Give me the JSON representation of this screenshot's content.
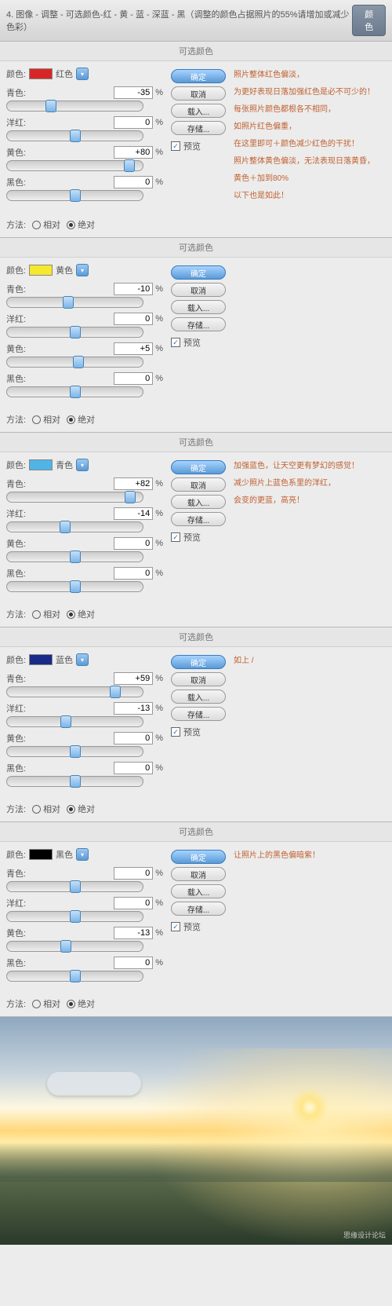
{
  "header": {
    "title": "4. 图像 - 调整 - 可选颜色-红 - 黄 - 蓝 - 深蓝 - 黑（调整的颜色占据照片的55%请增加或减少色彩）",
    "button": "颜色"
  },
  "panel_title": "可选颜色",
  "color_label_prefix": "颜色:",
  "slider_labels": {
    "cyan": "青色:",
    "magenta": "洋红:",
    "yellow": "黄色:",
    "black": "黑色:"
  },
  "buttons": {
    "ok": "确定",
    "cancel": "取消",
    "load": "载入...",
    "save": "存储..."
  },
  "preview": "预览",
  "method": {
    "label": "方法:",
    "relative": "相对",
    "absolute": "绝对"
  },
  "panels": [
    {
      "color_name": "红色",
      "swatch": "#d82626",
      "cyan": -35,
      "magenta": 0,
      "yellow": 80,
      "black": 0,
      "notes": [
        "照片整体红色偏淡，",
        "为更好表现日落加强红色是必不可少的！",
        "每张照片颜色都根各不相同，",
        "如照片红色偏重，",
        "在这里即可＋颜色减少红色的干扰！",
        "照片整体黄色偏淡，无法表现日落黄昏，",
        "黄色＋加到80%",
        "以下也是如此！"
      ]
    },
    {
      "color_name": "黄色",
      "swatch": "#f5e82e",
      "cyan": -10,
      "magenta": 0,
      "yellow": 5,
      "black": 0,
      "notes": []
    },
    {
      "color_name": "青色",
      "swatch": "#4fb4e6",
      "cyan": 82,
      "magenta": -14,
      "yellow": 0,
      "black": 0,
      "notes": [
        "加强蓝色，让天空更有梦幻的感觉！",
        "减少照片上蓝色系里的洋红，",
        "会变的更蓝，高亮！"
      ]
    },
    {
      "color_name": "蓝色",
      "swatch": "#1a2a88",
      "cyan": 59,
      "magenta": -13,
      "yellow": 0,
      "black": 0,
      "notes": [
        "如上 /"
      ]
    },
    {
      "color_name": "黑色",
      "swatch": "#000000",
      "cyan": 0,
      "magenta": 0,
      "yellow": -13,
      "black": 0,
      "notes": [
        "让照片上的黑色偏暗紫！"
      ]
    }
  ],
  "watermark": "思缘设计论坛",
  "percent": "%",
  "plus": "+"
}
